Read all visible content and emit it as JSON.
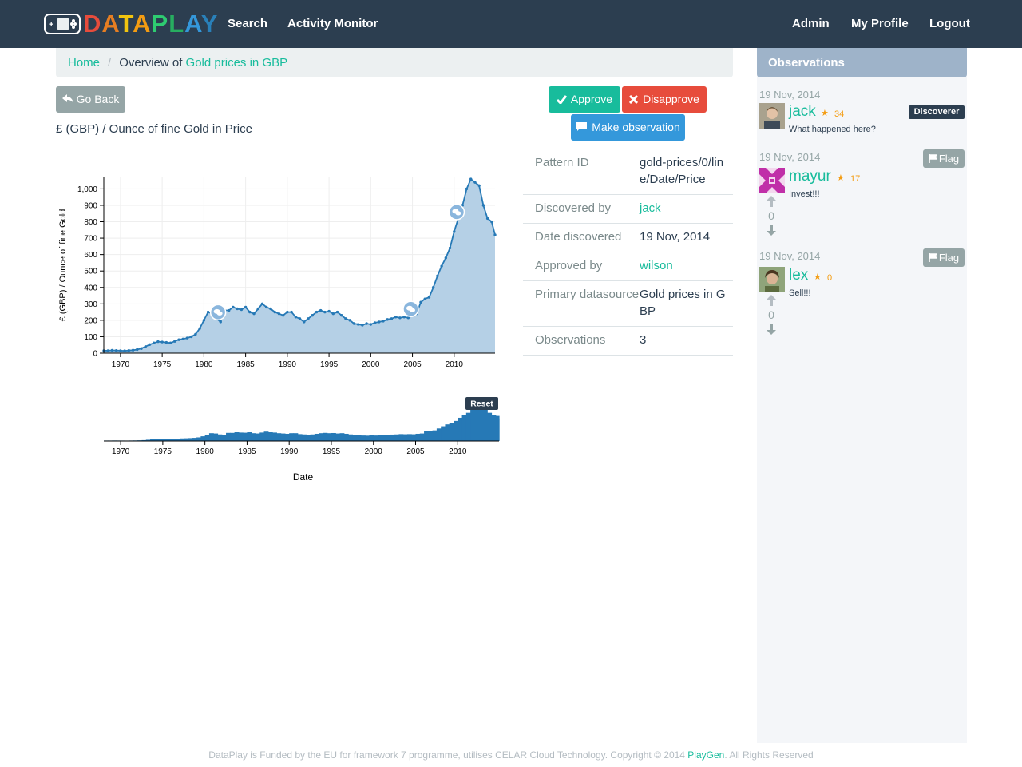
{
  "app": {
    "logo_text": "DATAPLAY",
    "logo_letters": [
      {
        "ch": "D",
        "color": "#e74c3c"
      },
      {
        "ch": "A",
        "color": "#e67e22"
      },
      {
        "ch": "T",
        "color": "#f1c40f"
      },
      {
        "ch": "A",
        "color": "#f39c12"
      },
      {
        "ch": "P",
        "color": "#2ecc71"
      },
      {
        "ch": "L",
        "color": "#27ae60"
      },
      {
        "ch": "A",
        "color": "#3498db"
      },
      {
        "ch": "Y",
        "color": "#2980b9"
      }
    ]
  },
  "nav": {
    "search": "Search",
    "activity": "Activity Monitor",
    "admin": "Admin",
    "profile": "My Profile",
    "logout": "Logout"
  },
  "breadcrumb": {
    "home": "Home",
    "sep": "/",
    "prefix": "Overview of ",
    "current": "Gold prices in GBP"
  },
  "actions": {
    "go_back": "Go Back",
    "approve": "Approve",
    "disapprove": "Disapprove",
    "make_observation": "Make observation"
  },
  "subtitle": "£ (GBP) / Ounce of fine Gold in Price",
  "info": {
    "pattern_id_label": "Pattern ID",
    "pattern_id": "gold-prices/0/line/Date/Price",
    "discovered_by_label": "Discovered by",
    "discovered_by": "jack",
    "date_label": "Date discovered",
    "date": "19 Nov, 2014",
    "approved_by_label": "Approved by",
    "approved_by": "wilson",
    "datasource_label": "Primary datasource",
    "datasource": "Gold prices in GBP",
    "observations_label": "Observations",
    "observations": "3"
  },
  "chart_data": {
    "type": "area",
    "ylabel": "£ (GBP) / Ounce of fine Gold",
    "xlabel": "Date",
    "ylim": [
      0,
      1070
    ],
    "xlim": [
      1968,
      2014.9
    ],
    "y_ticks": [
      0,
      100,
      200,
      300,
      400,
      500,
      600,
      700,
      800,
      900,
      1000
    ],
    "y_tick_labels": [
      "0",
      "100",
      "200",
      "300",
      "400",
      "500",
      "600",
      "700",
      "800",
      "900",
      "1,000"
    ],
    "x_ticks": [
      1970,
      1975,
      1980,
      1985,
      1990,
      1995,
      2000,
      2005,
      2010
    ],
    "x_tick_labels": [
      "1970",
      "1975",
      "1980",
      "1985",
      "1990",
      "1995",
      "2000",
      "2005",
      "2010"
    ],
    "x": [
      1968,
      1968.5,
      1969,
      1969.5,
      1970,
      1970.5,
      1971,
      1971.5,
      1972,
      1972.5,
      1973,
      1973.5,
      1974,
      1974.5,
      1975,
      1975.5,
      1976,
      1976.5,
      1977,
      1977.5,
      1978,
      1978.5,
      1979,
      1979.5,
      1980,
      1980.5,
      1981,
      1981.5,
      1982,
      1982.5,
      1983,
      1983.5,
      1984,
      1984.5,
      1985,
      1985.5,
      1986,
      1986.5,
      1987,
      1987.5,
      1988,
      1988.5,
      1989,
      1989.5,
      1990,
      1990.5,
      1991,
      1991.5,
      1992,
      1992.5,
      1993,
      1993.5,
      1994,
      1994.5,
      1995,
      1995.5,
      1996,
      1996.5,
      1997,
      1997.5,
      1998,
      1998.5,
      1999,
      1999.5,
      2000,
      2000.5,
      2001,
      2001.5,
      2002,
      2002.5,
      2003,
      2003.5,
      2004,
      2004.5,
      2005,
      2005.5,
      2006,
      2006.5,
      2007,
      2007.5,
      2008,
      2008.5,
      2009,
      2009.5,
      2010,
      2010.5,
      2011,
      2011.5,
      2012,
      2012.5,
      2013,
      2013.5,
      2014,
      2014.5,
      2014.9
    ],
    "series": [
      {
        "values": [
          15,
          15,
          17,
          16,
          15,
          14,
          16,
          18,
          22,
          28,
          40,
          52,
          62,
          70,
          68,
          65,
          62,
          72,
          82,
          86,
          92,
          100,
          115,
          150,
          200,
          250,
          240,
          210,
          190,
          260,
          260,
          280,
          270,
          265,
          280,
          250,
          240,
          270,
          300,
          280,
          270,
          250,
          240,
          230,
          250,
          250,
          220,
          210,
          190,
          210,
          230,
          250,
          260,
          250,
          255,
          240,
          250,
          230,
          210,
          200,
          180,
          175,
          170,
          180,
          175,
          185,
          190,
          195,
          205,
          210,
          220,
          215,
          220,
          215,
          230,
          240,
          310,
          330,
          340,
          400,
          470,
          530,
          580,
          640,
          740,
          820,
          900,
          1000,
          1060,
          1040,
          1020,
          900,
          820,
          800,
          720
        ]
      }
    ],
    "annotations": [
      1981.7,
      2004.8,
      2010.3
    ]
  },
  "range_chart": {
    "reset": "Reset"
  },
  "sidebar": {
    "title": "Observations",
    "observations": [
      {
        "date": "19 Nov, 2014",
        "user": "jack",
        "score": "34",
        "text": "What happened here?",
        "badge": "Discoverer"
      },
      {
        "date": "19 Nov, 2014",
        "user": "mayur",
        "score": "17",
        "text": "Invest!!!",
        "flag": "Flag",
        "votes": "0"
      },
      {
        "date": "19 Nov, 2014",
        "user": "lex",
        "score": "0",
        "text": "Sell!!!",
        "flag": "Flag",
        "votes": "0"
      }
    ]
  },
  "footer": {
    "text": "DataPlay is Funded by the EU for framework 7 programme, utilises CELAR Cloud Technology. Copyright © 2014 ",
    "link": "PlayGen",
    "suffix": ". All Rights Reserved"
  }
}
